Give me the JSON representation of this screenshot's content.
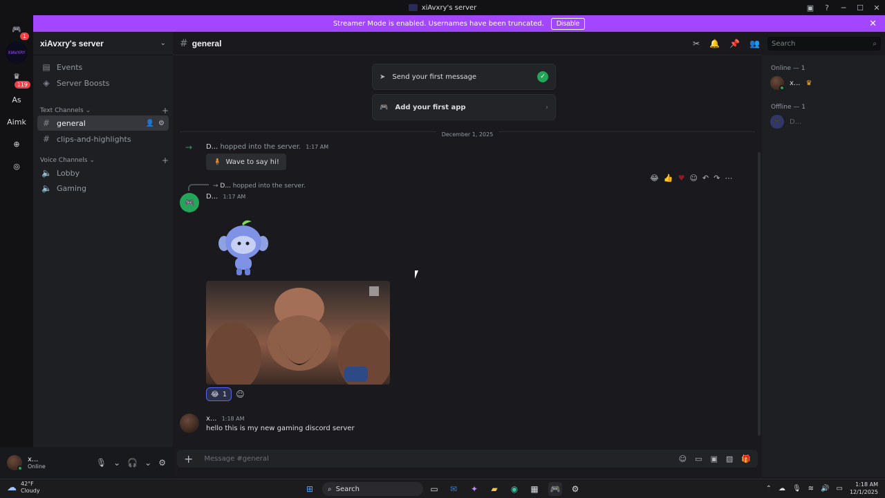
{
  "window": {
    "title": "xiAvxry's server"
  },
  "banner": {
    "text": "Streamer Mode is enabled. Usernames have been truncated.",
    "disable_label": "Disable",
    "color": "#a347ff"
  },
  "rail": {
    "home_badge": "1",
    "server1_label": "XIAVXRY",
    "server2_badge": "119",
    "server3_label": "As",
    "server4_label": "Aimk"
  },
  "sidebar": {
    "server_name": "xiAvxry's server",
    "top_items": [
      {
        "label": "Events"
      },
      {
        "label": "Server Boosts"
      }
    ],
    "text_category": "Text Channels",
    "text_channels": [
      {
        "label": "general"
      },
      {
        "label": "clips-and-highlights"
      }
    ],
    "voice_category": "Voice Channels",
    "voice_channels": [
      {
        "label": "Lobby"
      },
      {
        "label": "Gaming"
      }
    ]
  },
  "user_panel": {
    "name": "x...",
    "status": "Online"
  },
  "chat_header": {
    "channel": "general"
  },
  "search": {
    "placeholder": "Search"
  },
  "members": {
    "online_title": "Online — 1",
    "online_user": "x...",
    "offline_title": "Offline — 1",
    "offline_user": "D..."
  },
  "chat": {
    "card1": "Send your first message",
    "card2": "Add your first app",
    "date": "December 1, 2025",
    "sys1": {
      "user": "D...",
      "text": "hopped into the server.",
      "time": "1:17 AM"
    },
    "wave_label": "Wave to say hi!",
    "reply_preview": {
      "user": "D...",
      "text": "hopped into the server."
    },
    "bot_msg": {
      "user": "D...",
      "time": "1:17 AM"
    },
    "reaction": {
      "count": "1"
    },
    "user_msg": {
      "user": "x...",
      "time": "1:18 AM",
      "text": "hello this is my new gaming discord server"
    }
  },
  "composer": {
    "placeholder": "Message #general"
  },
  "taskbar": {
    "temp": "42°F",
    "weather": "Cloudy",
    "search_label": "Search",
    "time": "1:18 AM",
    "date": "12/1/2025"
  },
  "colors": {
    "accent": "#5865f2",
    "online": "#23a55a",
    "badge": "#f23f43"
  }
}
